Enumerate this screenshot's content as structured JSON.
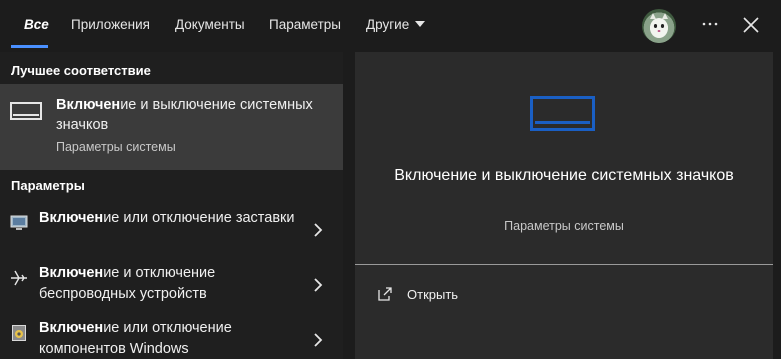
{
  "tabs": [
    {
      "label": "Все",
      "active": true
    },
    {
      "label": "Приложения",
      "active": false
    },
    {
      "label": "Документы",
      "active": false
    },
    {
      "label": "Параметры",
      "active": false
    },
    {
      "label": "Другие",
      "active": false,
      "has_dropdown": true
    }
  ],
  "header_icons": {
    "avatar": "user-avatar",
    "more": "more-horizontal-icon",
    "close": "close-icon"
  },
  "best_match": {
    "section_title": "Лучшее соответствие",
    "highlight": "Включен",
    "rest": "ие и выключение системных значков",
    "subtitle": "Параметры системы",
    "icon": "taskbar-icon"
  },
  "settings": {
    "section_title": "Параметры",
    "items": [
      {
        "highlight": "Включен",
        "rest": "ие или отключение заставки",
        "icon": "screensaver-icon"
      },
      {
        "highlight": "Включен",
        "rest": "ие и отключение беспроводных устройств",
        "icon": "airplane-icon"
      },
      {
        "highlight": "Включен",
        "rest": "ие или отключение компонентов Windows",
        "icon": "windows-features-icon"
      }
    ]
  },
  "preview": {
    "title": "Включение и выключение системных значков",
    "subtitle": "Параметры системы",
    "action_label": "Открыть",
    "icon": "taskbar-icon",
    "action_icon": "open-icon"
  },
  "colors": {
    "accent": "#4a90ff",
    "preview_icon": "#1a5fc4",
    "selected_bg": "#3b3b3b"
  }
}
